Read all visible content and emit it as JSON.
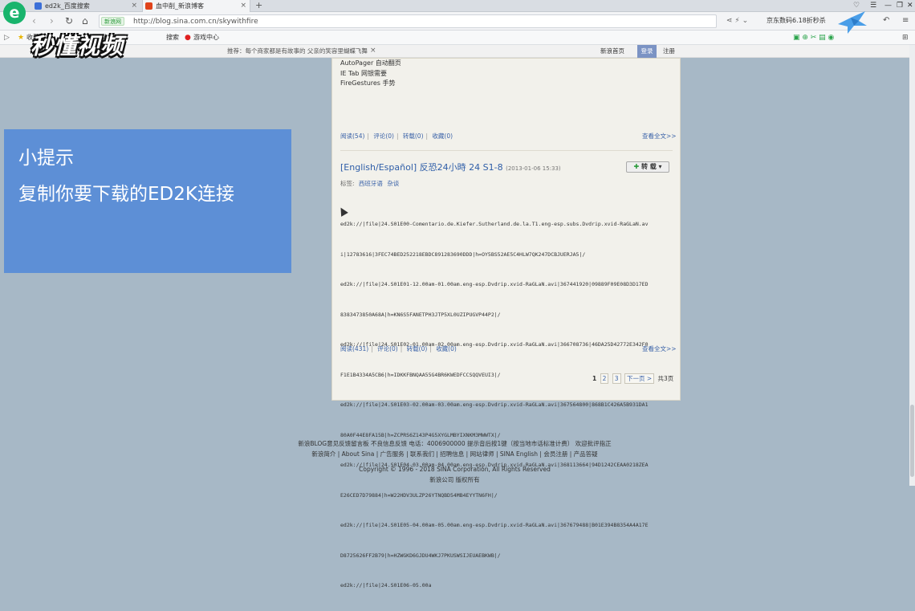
{
  "browser": {
    "tabs": [
      {
        "title": "ed2k_百度搜索",
        "close": "×"
      },
      {
        "title": "血中削_新浪博客",
        "close": "×"
      }
    ],
    "new_tab": "+",
    "address": {
      "badge": "新浪网",
      "url": "http://blog.sina.com.cn/skywithfire"
    },
    "promo": "京东数码6.18折秒杀",
    "bookmarks": [
      {
        "label": "收藏"
      },
      {
        "label": "云数"
      },
      {
        "label": "搜索"
      },
      {
        "label": "游戏中心"
      }
    ],
    "logo": "e"
  },
  "watermark": "秒懂视频",
  "sina_bar": {
    "notice": "推荐：每个商家都是有故事的   父亲的笑容里蝴蝶飞舞",
    "notice_close": "×",
    "home": "新浪首页",
    "login": "登录",
    "register": "注册"
  },
  "tip": {
    "line1": "小提示",
    "line2": "复制你要下载的ED2K连接"
  },
  "post1": {
    "plugins": [
      "AutoPager 自动翻页",
      "IE Tab 网银需要",
      "FireGestures 手势"
    ],
    "meta": {
      "read": "阅读(54)",
      "comment": "评论(0)",
      "repost": "转载(0)",
      "fav": "收藏(0)"
    },
    "more": "查看全文>>"
  },
  "post2": {
    "title": "[English/Español] 反恐24小時 24 S1-8",
    "date": "(2013-01-06 15:33)",
    "repost_button": "转 载",
    "tags_label": "标签:",
    "tags": [
      "西班牙语",
      "杂谈"
    ],
    "links": [
      "ed2k://|file|24.S01E00-Comentario.de.Kiefer.Sutherland.de.la.T1.eng-esp.subs.Dvdrip.xvid-RaGLaN.av",
      "i|12783616|3FEC74BED252218EBDC891283690DDD|h=OY5BS52AE5C4HLW7QK247DCBJUERJA5|/",
      "ed2k://|file|24.S01E01-12.00am-01.00am.eng-esp.Dvdrip.xvid-RaGLaN.avi|367441920|09889F09E08D3D17ED",
      "8383473850A68A|h=KN6S5FANETPH3JTP5XL0UZIPUGVP44P2|/",
      "ed2k://|file|24.S01E02-01.00am-02.00am.eng-esp.Dvdrip.xvid-RaGLaN.avi|366708736|46DA25D42772E342F0",
      "F1E1B4334A5CB6|h=IDKKFBNQAA55G4BR6KWEDFCCSQQVEUI3|/",
      "ed2k://|file|24.S01E03-02.00am-03.00am.eng-esp.Dvdrip.xvid-RaGLaN.avi|367564800|868B1C426A5B931DA1",
      "80A0F44E8FA15B|h=ZCPRS6Z143P4G5XYGLMBYIXNKM3MWWTX|/",
      "ed2k://|file|24.S01E04-03.00am-04.00am.eng-esp.Dvdrip.xvid-RaGLaN.avi|368113664|94D1242CEAA0218ZEA",
      "E26CED7D79884|h=W22HDV3ULZP26YTNQBD54MB4EYYTN6FH|/",
      "ed2k://|file|24.S01E05-04.00am-05.00am.eng-esp.Dvdrip.xvid-RaGLaN.avi|367679488|B01E394B8354A4A17E",
      "D8725626FF2B79|h=HZWGKD6GJDU4WKJ7PKUSWSIJEUAEBKWB|/",
      "ed2k://|file|24.S01E06-05.00a"
    ],
    "meta": {
      "read": "阅读(431)",
      "comment": "评论(0)",
      "repost": "转载(0)",
      "fav": "收藏(0)"
    },
    "more": "查看全文>>"
  },
  "pager": {
    "current": "1",
    "pages": [
      "2",
      "3"
    ],
    "next": "下一页 >",
    "total": "共3页"
  },
  "footer": {
    "line1": "新浪BLOG意见反馈留言板   不良信息反馈   电话：4006900000 提示音后按1键（按当地市话标准计费）   欢迎批评指正",
    "line2": "新浪简介 | About Sina | 广告服务 | 联系我们 | 招聘信息 | 网站律师 | SINA English | 会员注册 | 产品答疑",
    "line3": "Copyright © 1996 - 2018 SINA Corporation, All Rights Reserved",
    "line4": "新浪公司 版权所有"
  },
  "colors": {
    "accent_blue": "#2f5ea8",
    "tip_panel": "#5d8fd6",
    "page_bg": "#a7b8c6",
    "content_bg": "#f2f1eb"
  }
}
